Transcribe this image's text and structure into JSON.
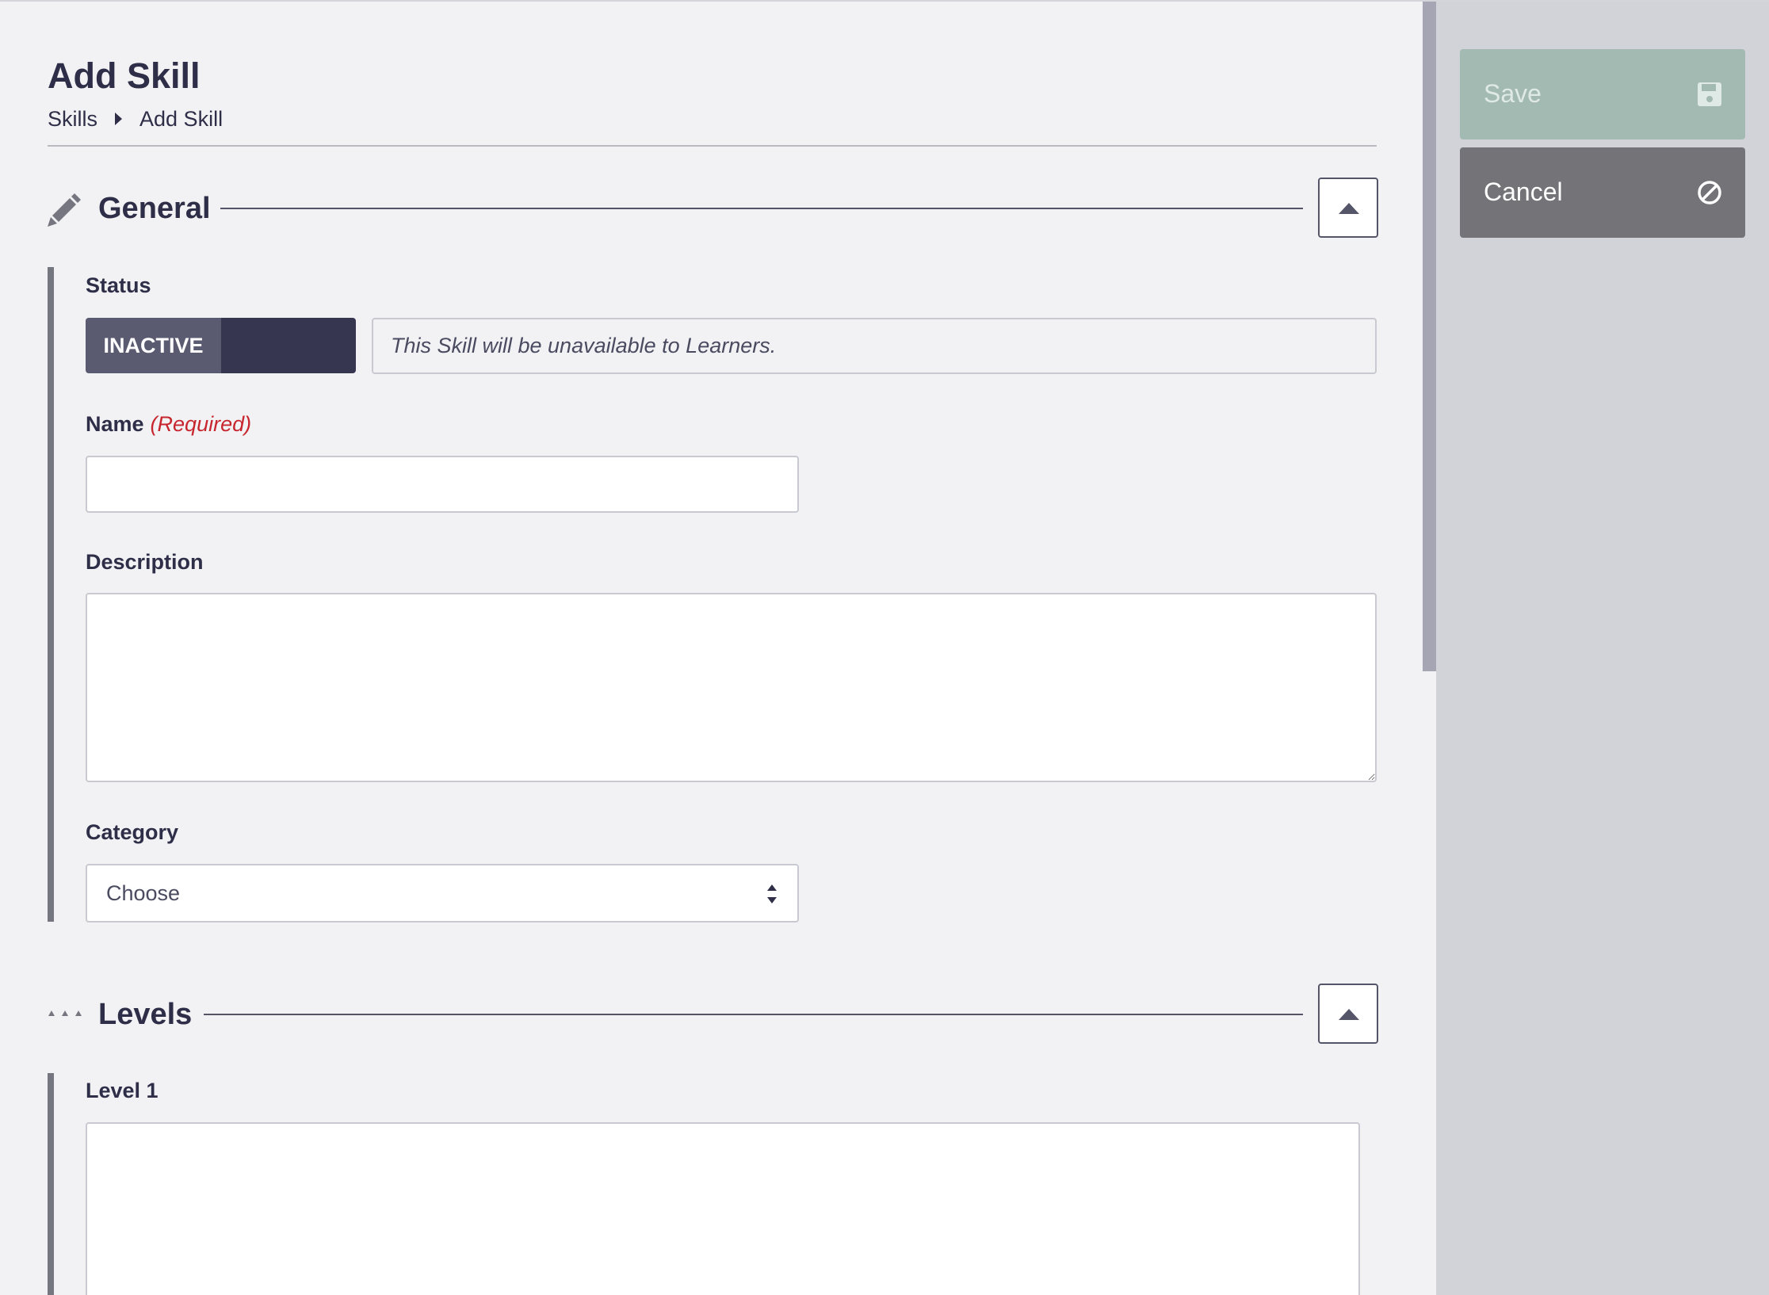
{
  "header": {
    "title": "Add Skill",
    "breadcrumb": [
      "Skills",
      "Add Skill"
    ]
  },
  "sections": {
    "general": {
      "title": "General",
      "icon": "pencil-icon",
      "status_label": "Status",
      "toggle_state": "INACTIVE",
      "status_message": "This Skill will be unavailable to Learners.",
      "name_label": "Name",
      "name_required": "(Required)",
      "name_value": "",
      "description_label": "Description",
      "description_value": "",
      "category_label": "Category",
      "category_value": "Choose"
    },
    "levels": {
      "title": "Levels",
      "icon": "ellipsis-icon",
      "level1_label": "Level 1",
      "level1_value": ""
    }
  },
  "actions": {
    "save_label": "Save",
    "save_icon": "floppy-disk-icon",
    "cancel_label": "Cancel",
    "cancel_icon": "ban-icon"
  },
  "colors": {
    "required": "#c8262e",
    "save_bg": "#a3bab2",
    "cancel_bg": "#737378",
    "toggle_bg": "#363650"
  }
}
